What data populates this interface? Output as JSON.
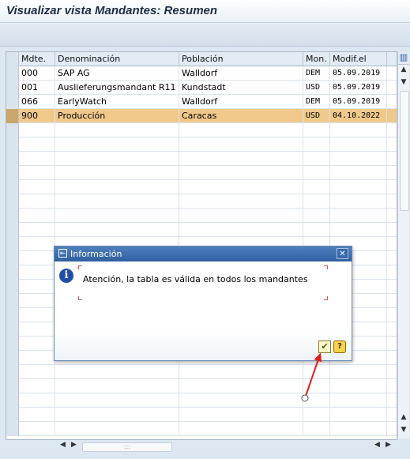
{
  "window": {
    "title": "Visualizar vista Mandantes: Resumen"
  },
  "table": {
    "columns": [
      "Mdte.",
      "Denominación",
      "Población",
      "Mon.",
      "Modif.el"
    ],
    "rows": [
      {
        "mandt": "000",
        "name": "SAP AG",
        "city": "Walldorf",
        "currency": "DEM",
        "changed": "05.09.2019"
      },
      {
        "mandt": "001",
        "name": "Auslieferungsmandant R11",
        "city": "Kundstadt",
        "currency": "USD",
        "changed": "05.09.2019"
      },
      {
        "mandt": "066",
        "name": "EarlyWatch",
        "city": "Walldorf",
        "currency": "DEM",
        "changed": "05.09.2019"
      },
      {
        "mandt": "900",
        "name": "Producción",
        "city": "Caracas",
        "currency": "USD",
        "changed": "04.10.2022"
      }
    ],
    "selected_row_color": "#f0c98a"
  },
  "dialog": {
    "title": "Información",
    "message": "Atención, la tabla es válida en todos los mandantes",
    "icons": {
      "title": "dialog-window-icon",
      "info": "information-icon",
      "close": "close-icon",
      "confirm": "checkmark-confirm-icon",
      "help": "help-question-icon"
    }
  },
  "annotation": {
    "arrow_color": "#e0201a"
  }
}
